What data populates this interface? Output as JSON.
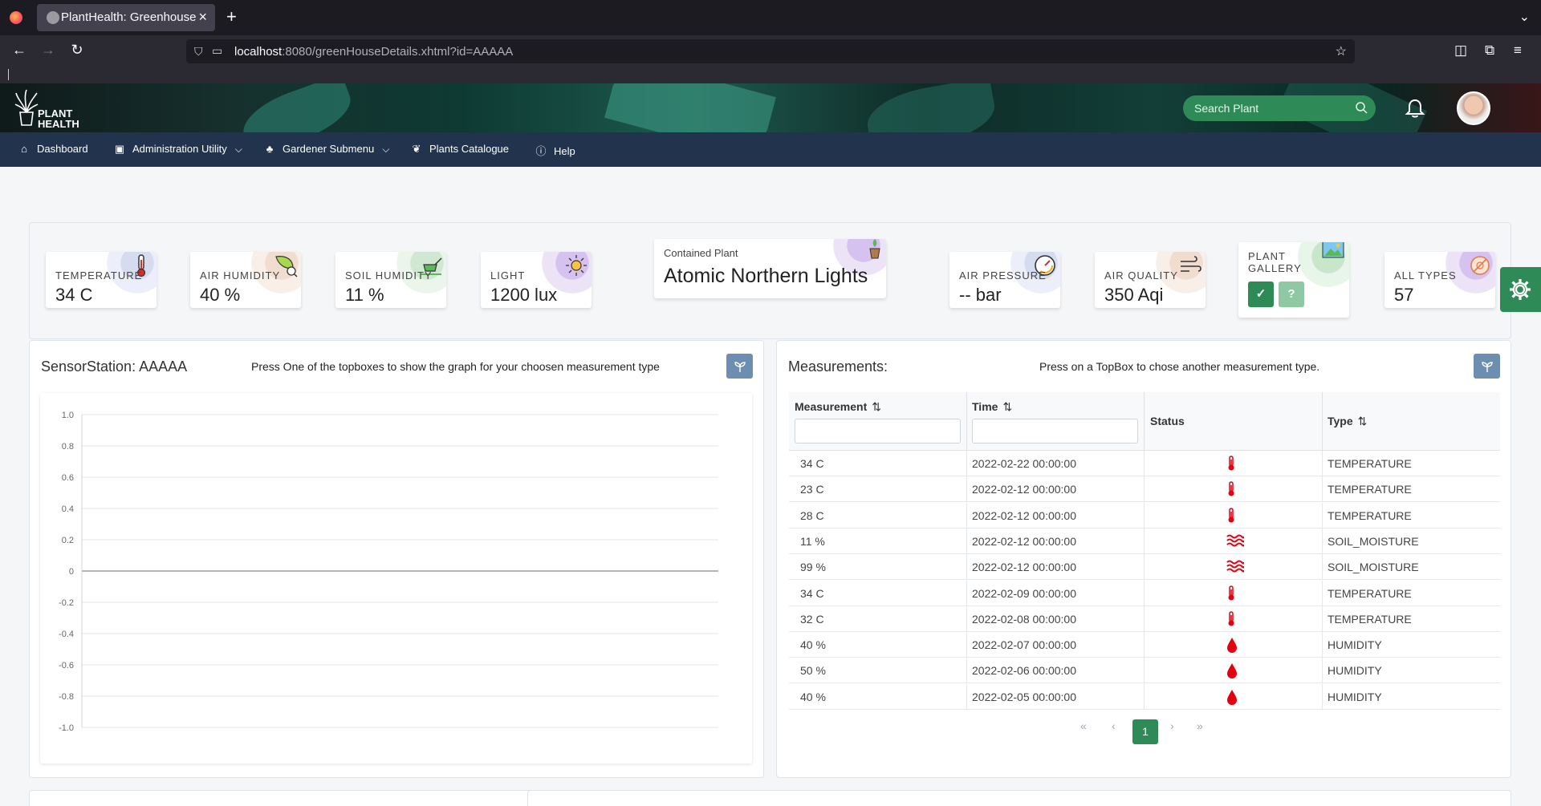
{
  "browser": {
    "tab_title": "PlantHealth: Greenhouse",
    "url_host": "localhost",
    "url_rest": ":8080/greenHouseDetails.xhtml?id=AAAAA"
  },
  "header": {
    "logo_line1": "PLANT",
    "logo_line2": "HEALTH",
    "search_placeholder": "Search Plant"
  },
  "menu": {
    "items": [
      {
        "label": "Dashboard"
      },
      {
        "label": "Administration Utility"
      },
      {
        "label": "Gardener Submenu"
      },
      {
        "label": "Plants Catalogue"
      },
      {
        "label": "Help"
      }
    ]
  },
  "topboxes": {
    "temperature": {
      "label": "TEMPERATURE",
      "value": "34 C"
    },
    "air_humidity": {
      "label": "AIR HUMIDITY",
      "value": "40 %"
    },
    "soil_humidity": {
      "label": "SOIL HUMIDITY",
      "value": "11 %"
    },
    "light": {
      "label": "LIGHT",
      "value": "1200 lux"
    },
    "contained": {
      "label": "Contained Plant",
      "value": "Atomic Northern Lights"
    },
    "air_pressure": {
      "label": "AIR PRESSURE",
      "value": "-- bar"
    },
    "air_quality": {
      "label": "AIR QUALITY",
      "value": "350 Aqi"
    },
    "gallery": {
      "label_line1": "PLANT",
      "label_line2": "GALLERY",
      "help_label": "?"
    },
    "all_types": {
      "label": "ALL TYPES",
      "value": "57"
    }
  },
  "sensor_panel": {
    "title": "SensorStation: AAAAA",
    "note": "Press One of the topboxes to show the graph for your choosen measurement type"
  },
  "chart_data": {
    "type": "line",
    "series": [],
    "ylim": [
      -1.0,
      1.0
    ],
    "yticks": [
      "1.0",
      "0.8",
      "0.6",
      "0.4",
      "0.2",
      "0",
      "-0.2",
      "-0.4",
      "-0.6",
      "-0.8",
      "-1.0"
    ],
    "grid": true
  },
  "measurements_panel": {
    "title": "Measurements:",
    "note": "Press on a TopBox to chose another measurement type.",
    "columns": [
      "Measurement",
      "Time",
      "Status",
      "Type"
    ],
    "rows": [
      {
        "measurement": "34 C",
        "time": "2022-02-22 00:00:00",
        "status": "thermometer",
        "type": "TEMPERATURE"
      },
      {
        "measurement": "23 C",
        "time": "2022-02-12 00:00:00",
        "status": "thermometer",
        "type": "TEMPERATURE"
      },
      {
        "measurement": "28 C",
        "time": "2022-02-12 00:00:00",
        "status": "thermometer",
        "type": "TEMPERATURE"
      },
      {
        "measurement": "11 %",
        "time": "2022-02-12 00:00:00",
        "status": "water-waves",
        "type": "SOIL_MOISTURE"
      },
      {
        "measurement": "99 %",
        "time": "2022-02-12 00:00:00",
        "status": "water-waves",
        "type": "SOIL_MOISTURE"
      },
      {
        "measurement": "34 C",
        "time": "2022-02-09 00:00:00",
        "status": "thermometer",
        "type": "TEMPERATURE"
      },
      {
        "measurement": "32 C",
        "time": "2022-02-08 00:00:00",
        "status": "thermometer",
        "type": "TEMPERATURE"
      },
      {
        "measurement": "40 %",
        "time": "2022-02-07 00:00:00",
        "status": "droplet",
        "type": "HUMIDITY"
      },
      {
        "measurement": "50 %",
        "time": "2022-02-06 00:00:00",
        "status": "droplet",
        "type": "HUMIDITY"
      },
      {
        "measurement": "40 %",
        "time": "2022-02-05 00:00:00",
        "status": "droplet",
        "type": "HUMIDITY"
      }
    ],
    "pagination": {
      "current_page": "1",
      "first": "«",
      "prev": "‹",
      "next": "›",
      "last": "»"
    }
  },
  "colors": {
    "brand_green": "#2e8b57",
    "menu_bg": "#22344d",
    "status_red": "#e3000f"
  }
}
